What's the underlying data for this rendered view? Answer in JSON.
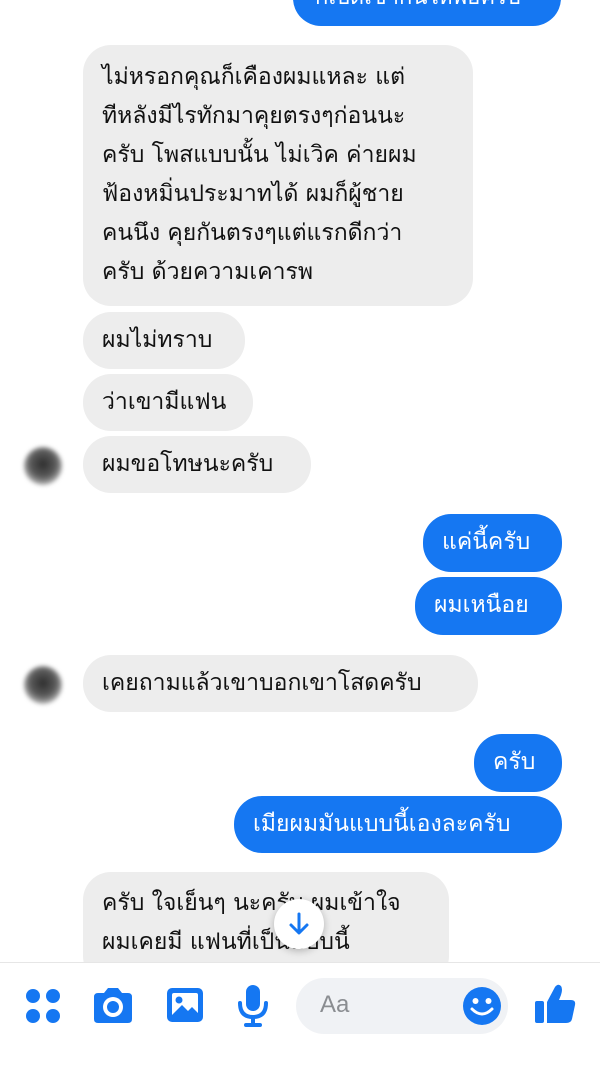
{
  "colors": {
    "outgoing_bubble": "#1577f2",
    "incoming_bubble": "#ededed",
    "accent": "#1577f2"
  },
  "messages": {
    "out_0": "ก็เปิดเข้ากันให้พอครับ",
    "in_1": "ไม่หรอกคุณก็เคืองผมแหละ แต่\nทีหลังมีไรทักมาคุยตรงๆก่อนนะ\nครับ โพสแบบนั้น ไม่เวิค ค่ายผม\nฟ้องหมิ่นประมาทได้ ผมก็ผู้ชาย\nคนนึง คุยกันตรงๆแต่แรกดีกว่า\nครับ ด้วยความเคารพ",
    "in_2": "ผมไม่ทราบ",
    "in_3": "ว่าเขามีแฟน",
    "in_4": "ผมขอโทษนะครับ",
    "out_5": "แค่นี้ครับ",
    "out_6": "ผมเหนือย",
    "in_7": "เคยถามแล้วเขาบอกเขาโสดครับ",
    "out_8": "ครับ",
    "out_9": "เมียผมมันแบบนี้เองละครับ",
    "in_10": "ครับ ใจเย็นๆ นะครับ ผมเข้าใจ\nผมเคยมี แฟนที่เป็นแบบนี้"
  },
  "composer": {
    "placeholder": "Aa",
    "icons": [
      "apps-icon",
      "camera-icon",
      "gallery-icon",
      "microphone-icon",
      "emoji-icon",
      "thumbs-up-icon"
    ]
  },
  "scroll_button_icon": "arrow-down-icon"
}
